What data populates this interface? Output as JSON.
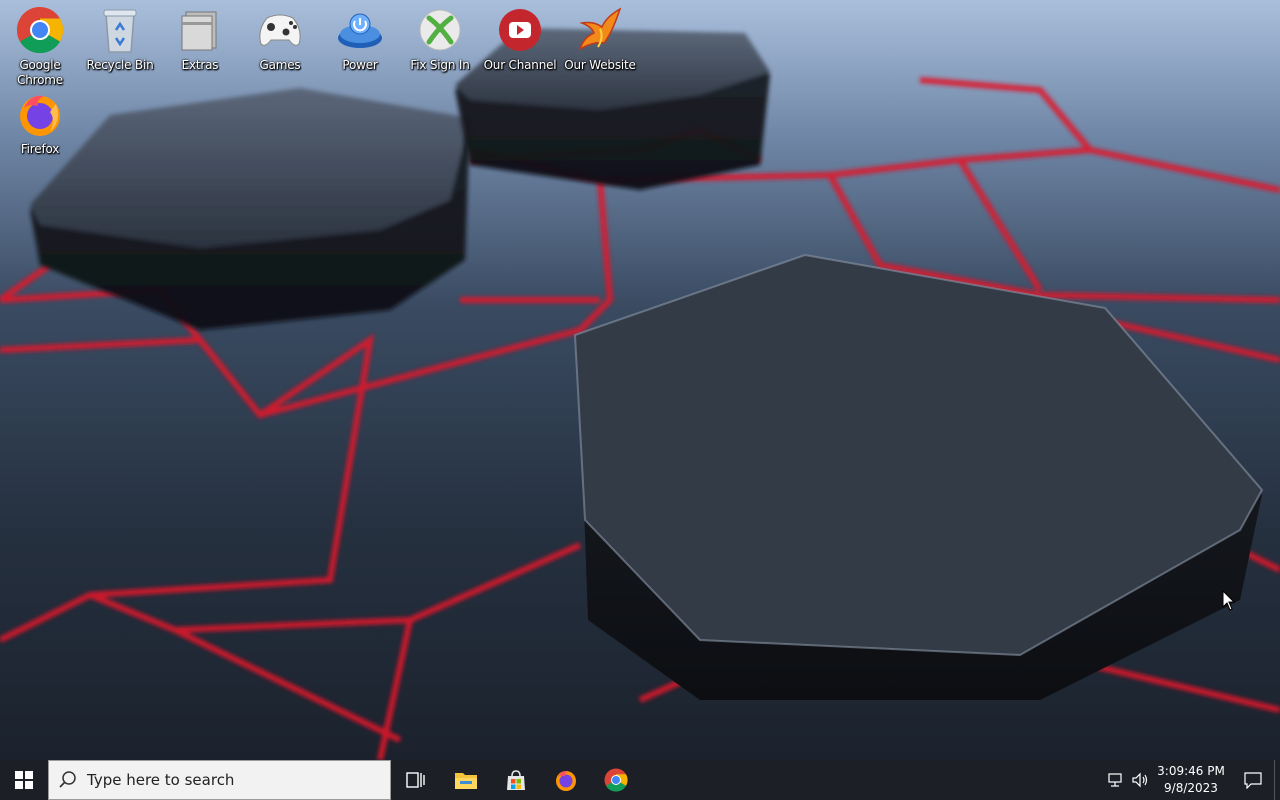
{
  "desktop": {
    "icons": [
      {
        "label": "Google Chrome",
        "icon": "chrome-icon"
      },
      {
        "label": "Recycle Bin",
        "icon": "recycle-bin-icon"
      },
      {
        "label": "Extras",
        "icon": "folder-stack-icon"
      },
      {
        "label": "Games",
        "icon": "gamepad-icon"
      },
      {
        "label": "Power",
        "icon": "power-orb-icon"
      },
      {
        "label": "Fix Sign In",
        "icon": "xbox-icon"
      },
      {
        "label": "Our Channel",
        "icon": "youtube-icon"
      },
      {
        "label": "Our Website",
        "icon": "phoenix-logo-icon"
      },
      {
        "label": "Firefox",
        "icon": "firefox-icon"
      }
    ]
  },
  "taskbar": {
    "search_placeholder": "Type here to search",
    "pinned": [
      "task-view-icon",
      "file-explorer-icon",
      "store-icon",
      "firefox-icon",
      "chrome-icon"
    ],
    "clock": {
      "time": "3:09:46 PM",
      "date": "9/8/2023"
    }
  },
  "colors": {
    "taskbar_bg": "#1c1f26",
    "accent_red": "#e0192a",
    "search_bg": "#f2f2f2"
  }
}
